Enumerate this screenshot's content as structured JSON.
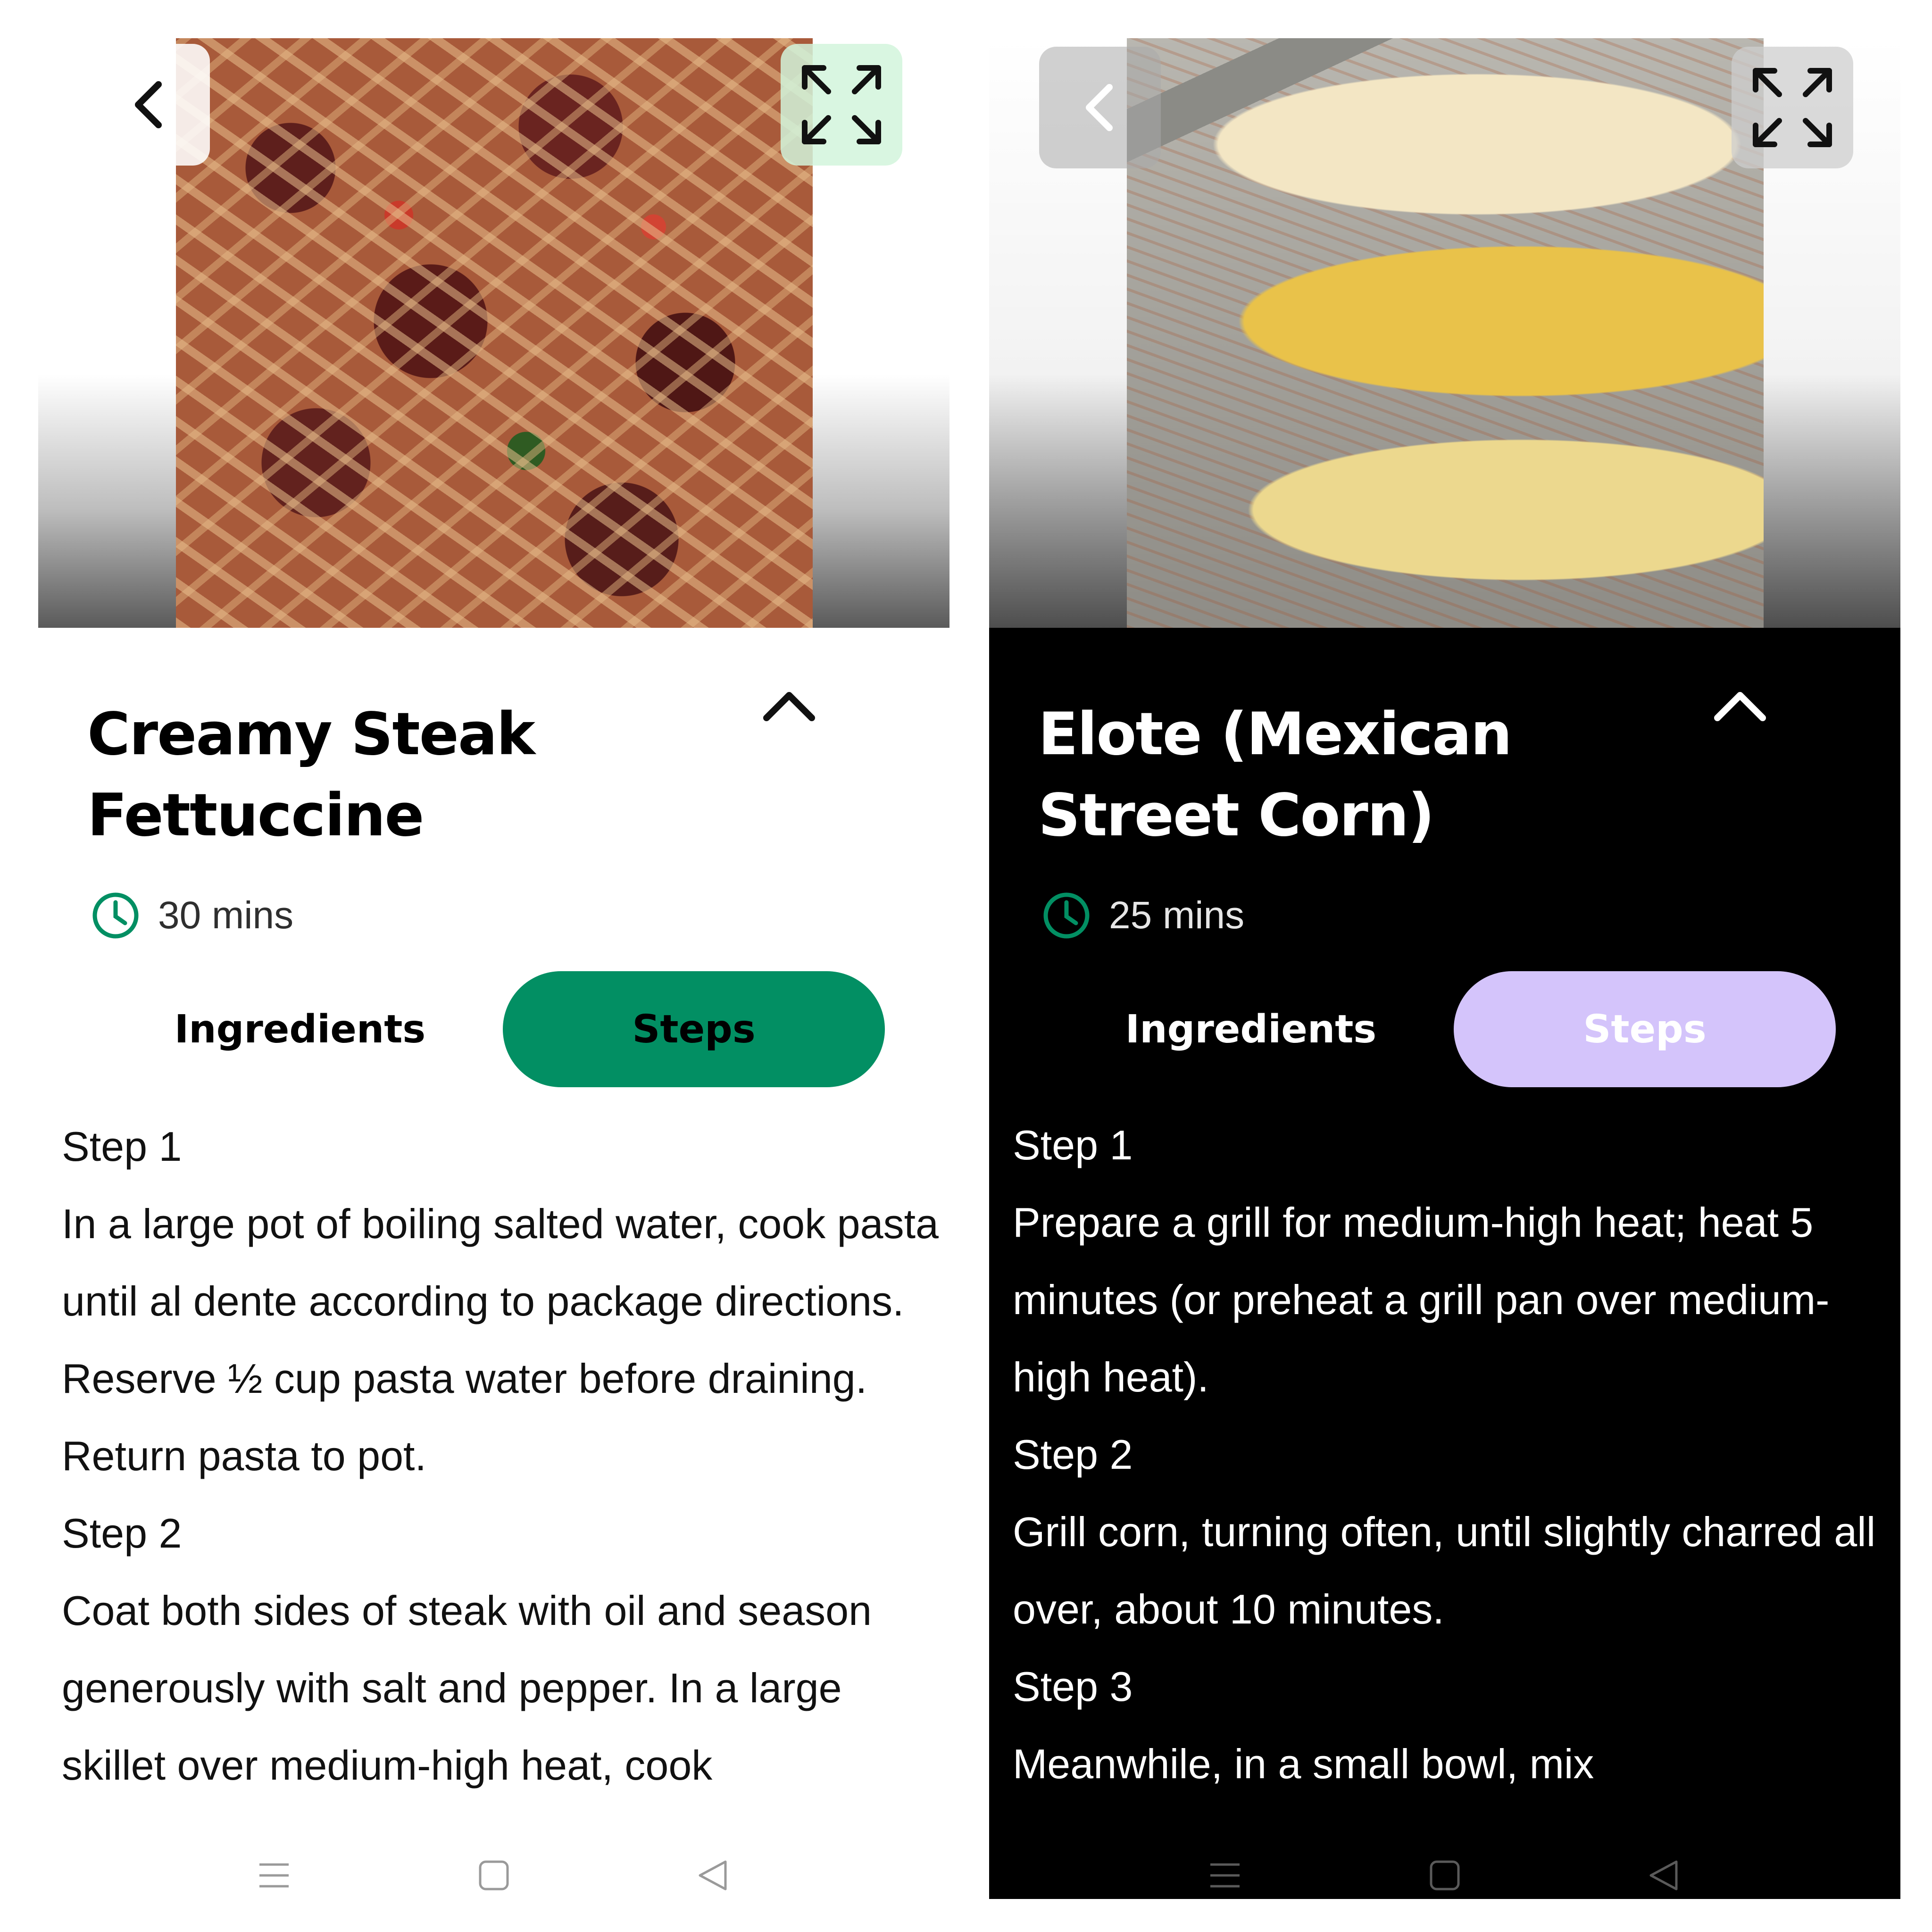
{
  "left_screen": {
    "theme": "light",
    "accent_color": "#028f63",
    "title": "Creamy Steak Fettuccine",
    "time": "30 mins",
    "tabs": {
      "ingredients": "Ingredients",
      "steps": "Steps"
    },
    "active_tab": "steps",
    "steps": [
      {
        "label": "Step 1",
        "text": "In a large pot of boiling salted water, cook pasta until al dente according to package directions. Reserve ½ cup pasta water before draining. Return pasta to pot."
      },
      {
        "label": "Step 2",
        "text": "Coat both sides of steak with oil and season generously with salt and pepper. In a large skillet over medium-high heat, cook"
      }
    ],
    "icons": {
      "back": "chevron-left-icon",
      "expand": "expand-icon",
      "collapse": "chevron-up-icon",
      "time": "clock-icon"
    }
  },
  "right_screen": {
    "theme": "dark",
    "accent_color": "#d4c4fb",
    "title": "Elote (Mexican Street Corn)",
    "time": "25 mins",
    "tabs": {
      "ingredients": "Ingredients",
      "steps": "Steps"
    },
    "active_tab": "steps",
    "steps": [
      {
        "label": "Step 1",
        "text": "Prepare a grill for medium-high heat; heat 5 minutes (or preheat a grill pan over medium-high heat)."
      },
      {
        "label": "Step 2",
        "text": "Grill corn, turning often, until slightly charred all over, about 10 minutes."
      },
      {
        "label": "Step 3",
        "text": "Meanwhile, in a small bowl, mix"
      }
    ],
    "icons": {
      "back": "chevron-left-icon",
      "expand": "expand-icon",
      "collapse": "chevron-up-icon",
      "time": "clock-icon"
    }
  },
  "system_nav": {
    "icons": [
      "menu-icon",
      "home-icon",
      "back-icon"
    ]
  }
}
